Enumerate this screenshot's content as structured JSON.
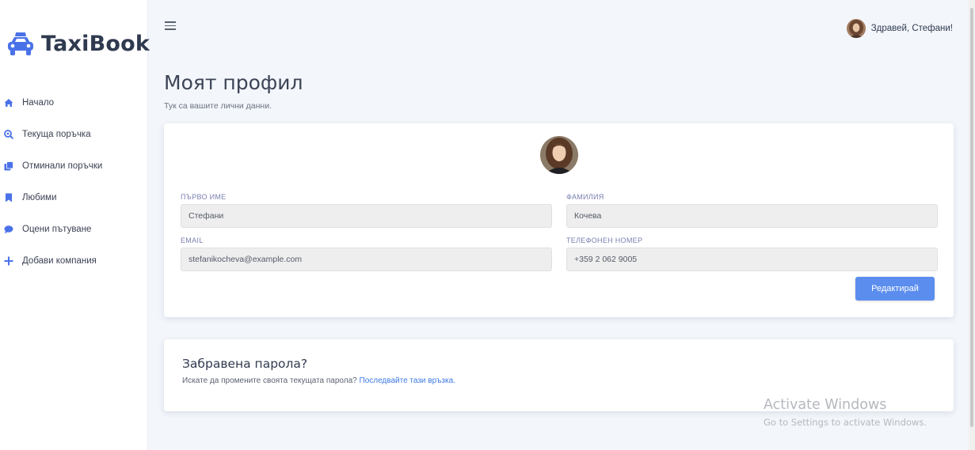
{
  "sidebar": {
    "brand": "TaxiBook",
    "items": [
      {
        "label": "Начало",
        "icon": "home-icon"
      },
      {
        "label": "Текуща поръчка",
        "icon": "search-location-icon"
      },
      {
        "label": "Отминали поръчки",
        "icon": "copy-icon"
      },
      {
        "label": "Любими",
        "icon": "bookmark-icon"
      },
      {
        "label": "Оцени пътуване",
        "icon": "comment-icon"
      },
      {
        "label": "Добави компания",
        "icon": "plus-icon"
      }
    ]
  },
  "topbar": {
    "greeting": "Здравей, Стефани!"
  },
  "page": {
    "title": "Моят профил",
    "subtitle": "Тук са вашите лични данни."
  },
  "profile": {
    "first_name_label": "ПЪРВО ИМЕ",
    "first_name_value": "Стефани",
    "last_name_label": "ФАМИЛИЯ",
    "last_name_value": "Кочева",
    "email_label": "EMAIL",
    "email_value": "stefanikocheva@example.com",
    "phone_label": "ТЕЛЕФОНЕН НОМЕР",
    "phone_value": "+359 2 062 9005",
    "edit_button": "Редактирай"
  },
  "password": {
    "title": "Забравена парола?",
    "text": "Искате да промените своята текущата парола?",
    "link": "Последвайте тази връзка."
  },
  "watermark": {
    "title": "Activate Windows",
    "subtitle": "Go to Settings to activate Windows."
  },
  "colors": {
    "accent": "#4a72e8",
    "button": "#5b8def",
    "link": "#3d79e6",
    "background": "#f3f6fb"
  }
}
